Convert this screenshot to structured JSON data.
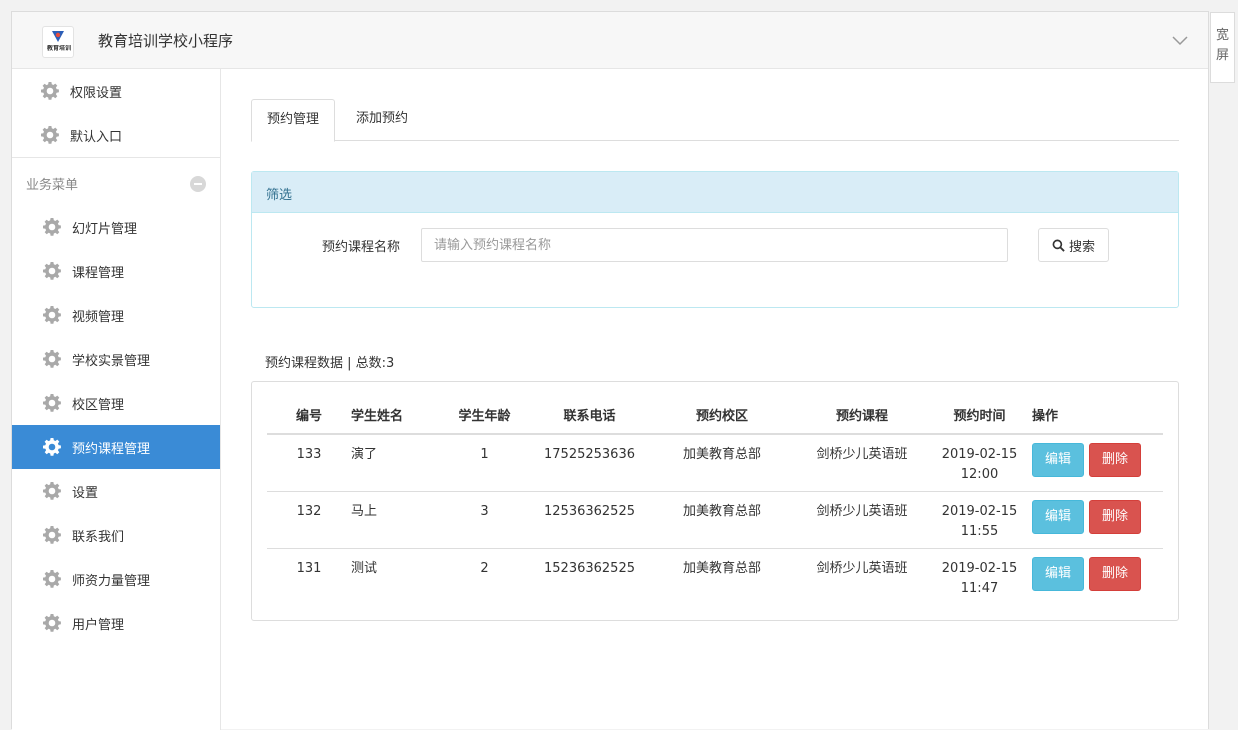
{
  "header": {
    "app_title": "教育培训学校小程序",
    "logo_text": "教育培训"
  },
  "wide_button": {
    "line1": "宽",
    "line2": "屏"
  },
  "sidebar": {
    "top_items": [
      {
        "label": "权限设置"
      },
      {
        "label": "默认入口"
      }
    ],
    "section_label": "业务菜单",
    "items": [
      {
        "label": "幻灯片管理"
      },
      {
        "label": "课程管理"
      },
      {
        "label": "视频管理"
      },
      {
        "label": "学校实景管理"
      },
      {
        "label": "校区管理"
      },
      {
        "label": "预约课程管理"
      },
      {
        "label": "设置"
      },
      {
        "label": "联系我们"
      },
      {
        "label": "师资力量管理"
      },
      {
        "label": "用户管理"
      }
    ],
    "active_index": 5
  },
  "tabs": [
    {
      "label": "预约管理"
    },
    {
      "label": "添加预约"
    }
  ],
  "filter": {
    "title": "筛选",
    "field_label": "预约课程名称",
    "placeholder": "请输入预约课程名称",
    "value": "",
    "search_label": "搜索"
  },
  "data_caption": "预约课程数据 | 总数:3",
  "table": {
    "headers": [
      "编号",
      "学生姓名",
      "学生年龄",
      "联系电话",
      "预约校区",
      "预约课程",
      "预约时间",
      "操作"
    ],
    "rows": [
      {
        "id": "133",
        "name": "演了",
        "age": "1",
        "phone": "17525253636",
        "campus": "加美教育总部",
        "course": "剑桥少儿英语班",
        "date": "2019-02-15",
        "time": "12:00"
      },
      {
        "id": "132",
        "name": "马上",
        "age": "3",
        "phone": "12536362525",
        "campus": "加美教育总部",
        "course": "剑桥少儿英语班",
        "date": "2019-02-15",
        "time": "11:55"
      },
      {
        "id": "131",
        "name": "测试",
        "age": "2",
        "phone": "15236362525",
        "campus": "加美教育总部",
        "course": "剑桥少儿英语班",
        "date": "2019-02-15",
        "time": "11:47"
      }
    ],
    "edit_label": "编辑",
    "delete_label": "删除"
  },
  "colors": {
    "active_nav": "#3a8bd6",
    "panel_head": "#d9edf7",
    "edit_button": "#5bc0de",
    "delete_button": "#d9534f"
  }
}
